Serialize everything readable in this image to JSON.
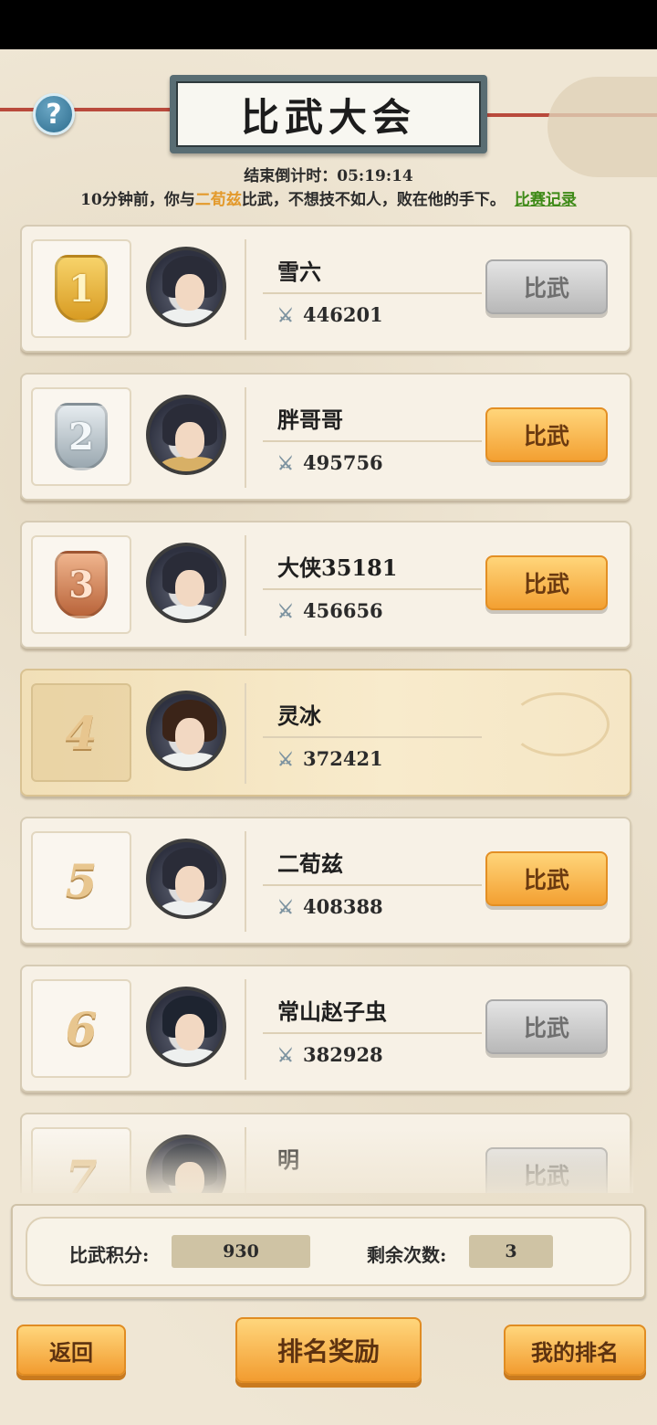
{
  "header": {
    "title": "比武大会",
    "help_label": "?",
    "countdown_label": "结束倒计时：",
    "countdown_value": "05:19:14"
  },
  "news": {
    "prefix": "10分钟前，你与",
    "opponent": "二荀兹",
    "suffix": "比武，不想技不如人，败在他的手下。",
    "record_link": "比赛记录"
  },
  "ranking": [
    {
      "rank": "1",
      "medal": "gold",
      "name": "雪六",
      "power": "446201",
      "button": "比武",
      "button_state": "disabled"
    },
    {
      "rank": "2",
      "medal": "silver",
      "name": "胖哥哥",
      "power": "495756",
      "button": "比武",
      "button_state": "active"
    },
    {
      "rank": "3",
      "medal": "bronze",
      "name": "大侠35181",
      "power": "456656",
      "button": "比武",
      "button_state": "active"
    },
    {
      "rank": "4",
      "medal": "none",
      "name": "灵冰",
      "power": "372421",
      "button": "",
      "button_state": "self"
    },
    {
      "rank": "5",
      "medal": "none",
      "name": "二荀兹",
      "power": "408388",
      "button": "比武",
      "button_state": "active"
    },
    {
      "rank": "6",
      "medal": "none",
      "name": "常山赵子虫",
      "power": "382928",
      "button": "比武",
      "button_state": "disabled"
    },
    {
      "rank": "7",
      "medal": "none",
      "name": "明",
      "power": "",
      "button": "比武",
      "button_state": "disabled"
    }
  ],
  "score": {
    "points_label": "比武积分:",
    "points_value": "930",
    "remaining_label": "剩余次数:",
    "remaining_value": "3"
  },
  "bottom": {
    "back": "返回",
    "rewards": "排名奖励",
    "my_rank": "我的排名"
  },
  "icons": {
    "sword": "crossed-swords-icon",
    "help": "question-icon"
  },
  "colors": {
    "accent_orange": "#f3a032",
    "link_green": "#3e8a17",
    "highlight_name": "#e39a2c"
  }
}
